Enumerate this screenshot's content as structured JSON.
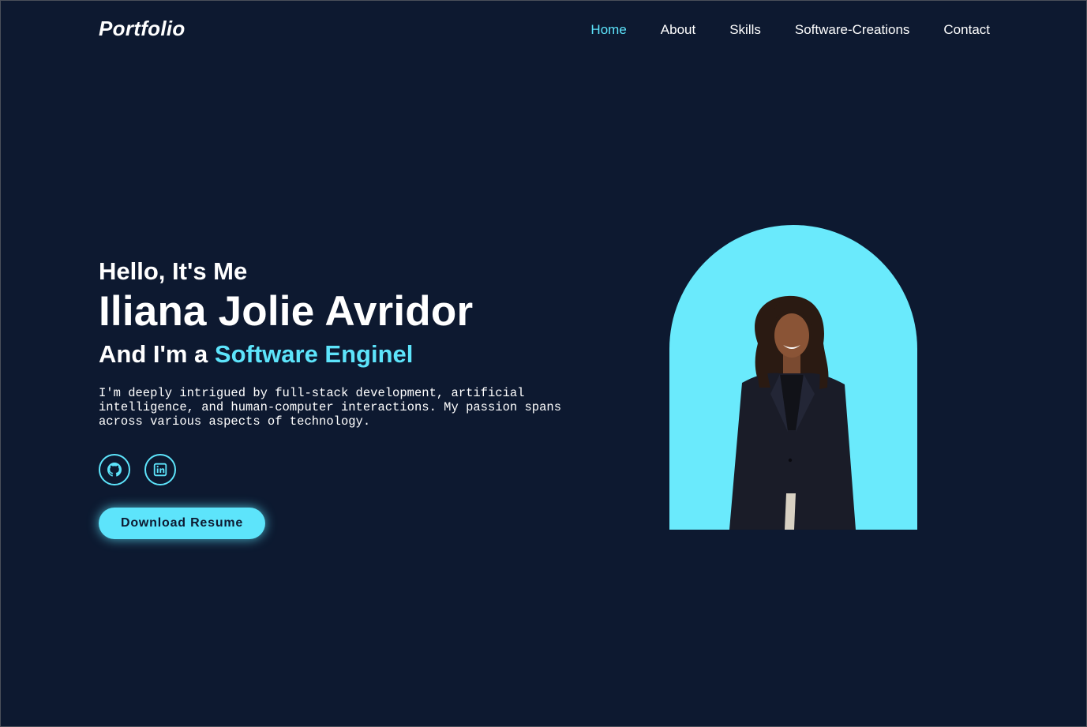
{
  "header": {
    "logo": "Portfolio",
    "nav": [
      {
        "label": "Home",
        "active": true
      },
      {
        "label": "About",
        "active": false
      },
      {
        "label": "Skills",
        "active": false
      },
      {
        "label": "Software-Creations",
        "active": false
      },
      {
        "label": "Contact",
        "active": false
      }
    ]
  },
  "hero": {
    "greeting": "Hello, It's Me",
    "name": "Iliana Jolie Avridor",
    "role_prefix": "And I'm a ",
    "role_highlight": "Software Enginel",
    "description": "I'm deeply intrigued by full-stack development, artificial intelligence, and human-computer interactions. My passion spans across various aspects of technology.",
    "socials": [
      {
        "icon": "github-icon"
      },
      {
        "icon": "linkedin-icon"
      }
    ],
    "resume_button": "Download Resume"
  },
  "colors": {
    "background": "#0d1930",
    "accent": "#5de4fb",
    "arch": "#6aeafc",
    "text": "#ffffff"
  }
}
